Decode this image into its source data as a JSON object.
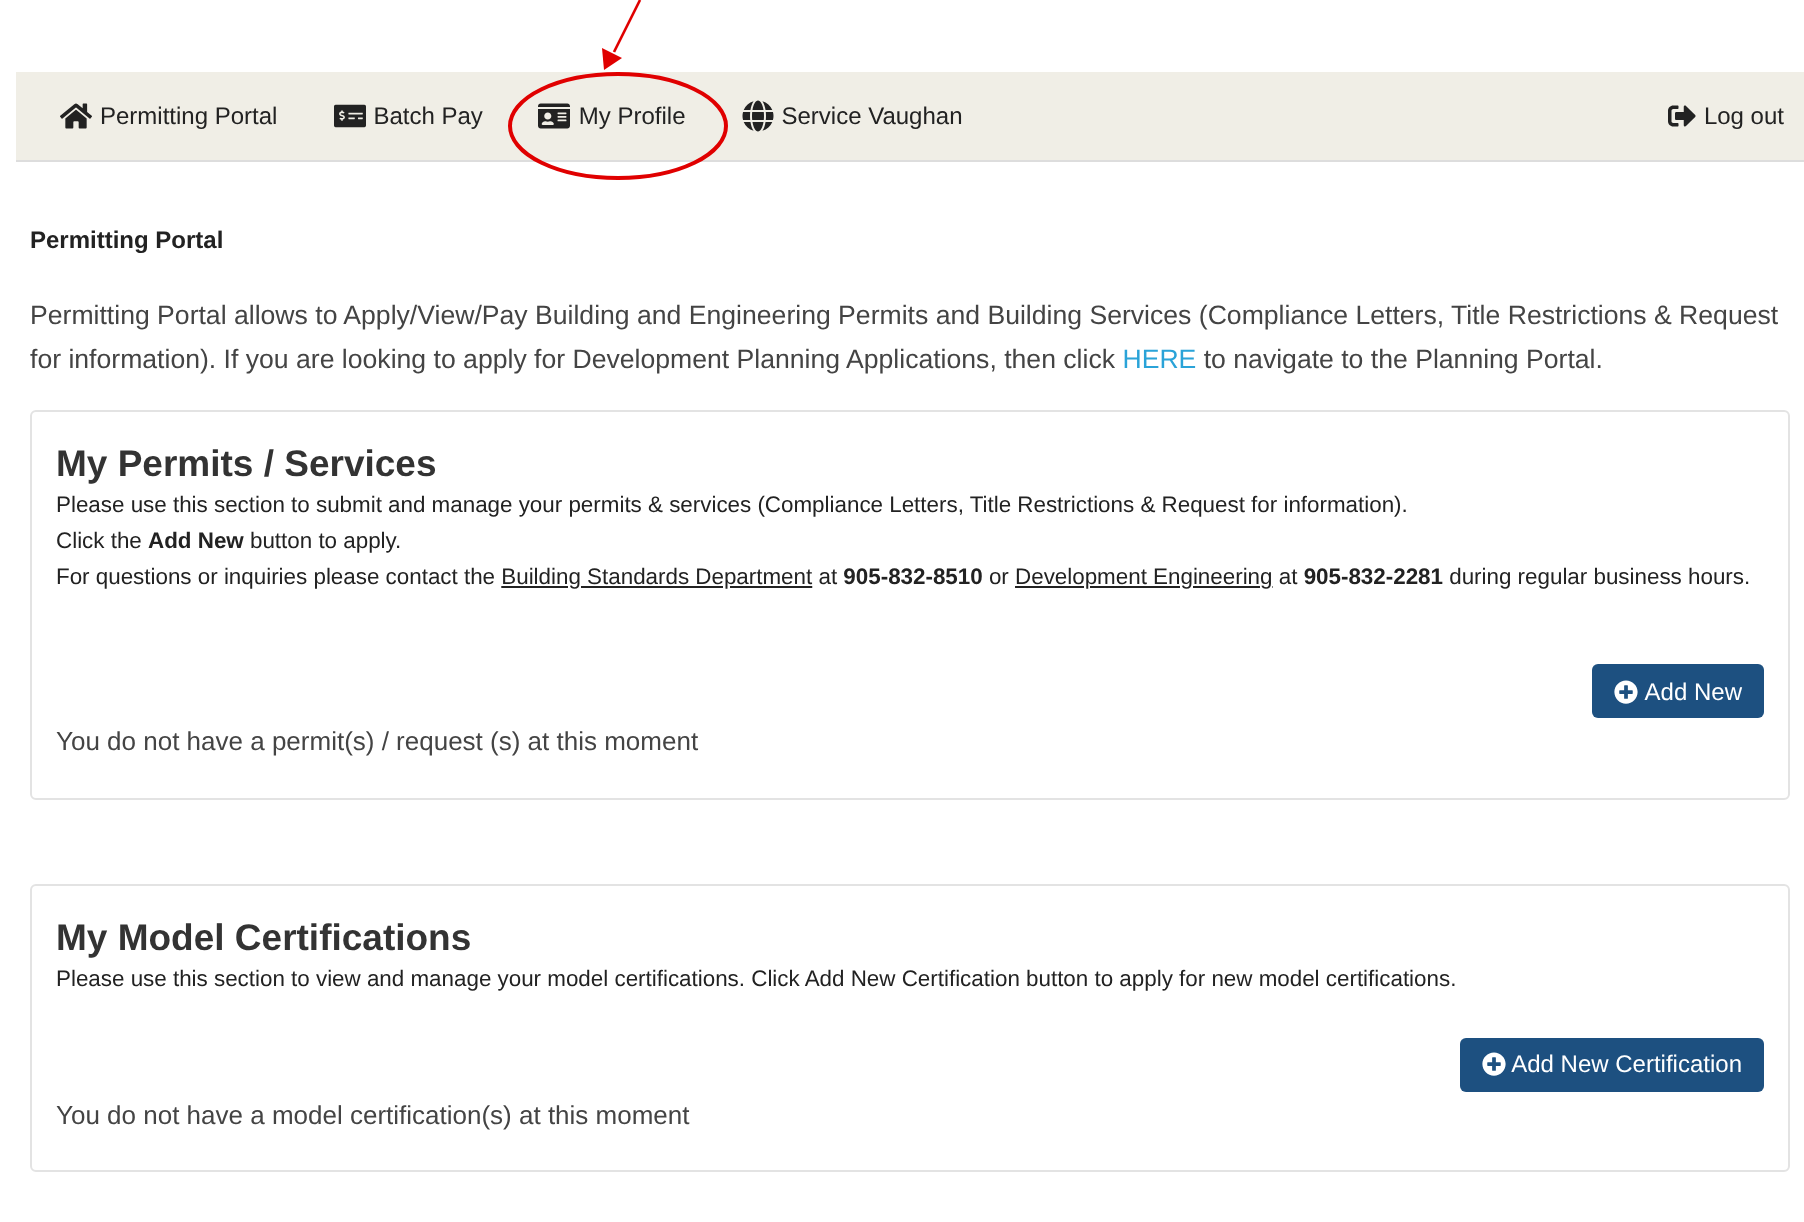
{
  "nav": {
    "items": [
      {
        "label": "Permitting Portal",
        "annotated": false
      },
      {
        "label": "Batch Pay",
        "annotated": false
      },
      {
        "label": "My Profile",
        "annotated": true
      },
      {
        "label": "Service Vaughan",
        "annotated": false
      }
    ],
    "logout": "Log out"
  },
  "page_title": "Permitting Portal",
  "intro": [
    {
      "kind": "text",
      "text": "Permitting Portal allows to Apply/View/Pay Building and Engineering Permits and Building Services (Compliance Letters, Title Restrictions & Request for information). If you are looking to apply for Development Planning Applications, then click "
    },
    {
      "kind": "link",
      "text": "HERE"
    },
    {
      "kind": "text",
      "text": " to navigate to the Planning Portal."
    }
  ],
  "cards": [
    {
      "title": "My Permits / Services",
      "lines": [
        [
          {
            "kind": "text",
            "text": "Please use this section to submit and manage your permits & services (Compliance Letters, Title Restrictions & Request for information)."
          }
        ],
        [
          {
            "kind": "text",
            "text": "Click the **Add New** button to apply."
          }
        ],
        [
          {
            "kind": "text",
            "text": "For questions or inquiries please contact the "
          },
          {
            "kind": "link",
            "text": "Building Standards Department"
          },
          {
            "kind": "text",
            "text": " at **905-832-8510** or "
          },
          {
            "kind": "link",
            "text": "Development Engineering"
          },
          {
            "kind": "text",
            "text": " at **905-832-2281** during regular business hours."
          }
        ]
      ],
      "button": "Add New",
      "empty_message": "You do not have a permit(s) / request (s) at this moment"
    },
    {
      "title": "My Model Certifications",
      "lines": [
        [
          {
            "kind": "text",
            "text": "Please use this section to view and manage your model certifications. Click Add New Certification button to apply for new model certifications."
          }
        ]
      ],
      "button": "Add New Certification",
      "empty_message": "You do not have a model certification(s) at this moment"
    }
  ]
}
